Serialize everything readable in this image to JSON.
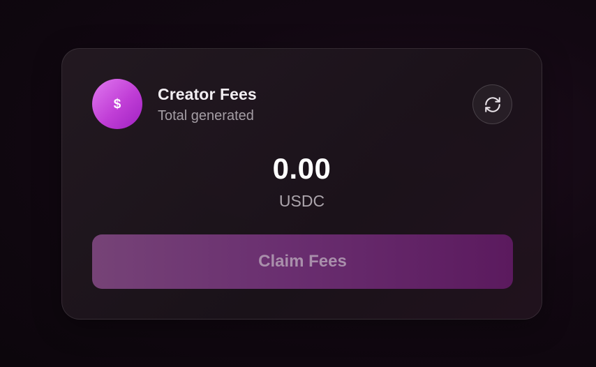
{
  "card": {
    "icon": "dollar-icon",
    "icon_glyph": "$",
    "title": "Creator Fees",
    "subtitle": "Total generated",
    "refresh_icon": "refresh-icon"
  },
  "balance": {
    "amount": "0.00",
    "currency": "USDC"
  },
  "actions": {
    "claim_label": "Claim Fees"
  },
  "colors": {
    "accent": "#c03ed6",
    "button": "#6a2f70",
    "background": "#120812"
  }
}
